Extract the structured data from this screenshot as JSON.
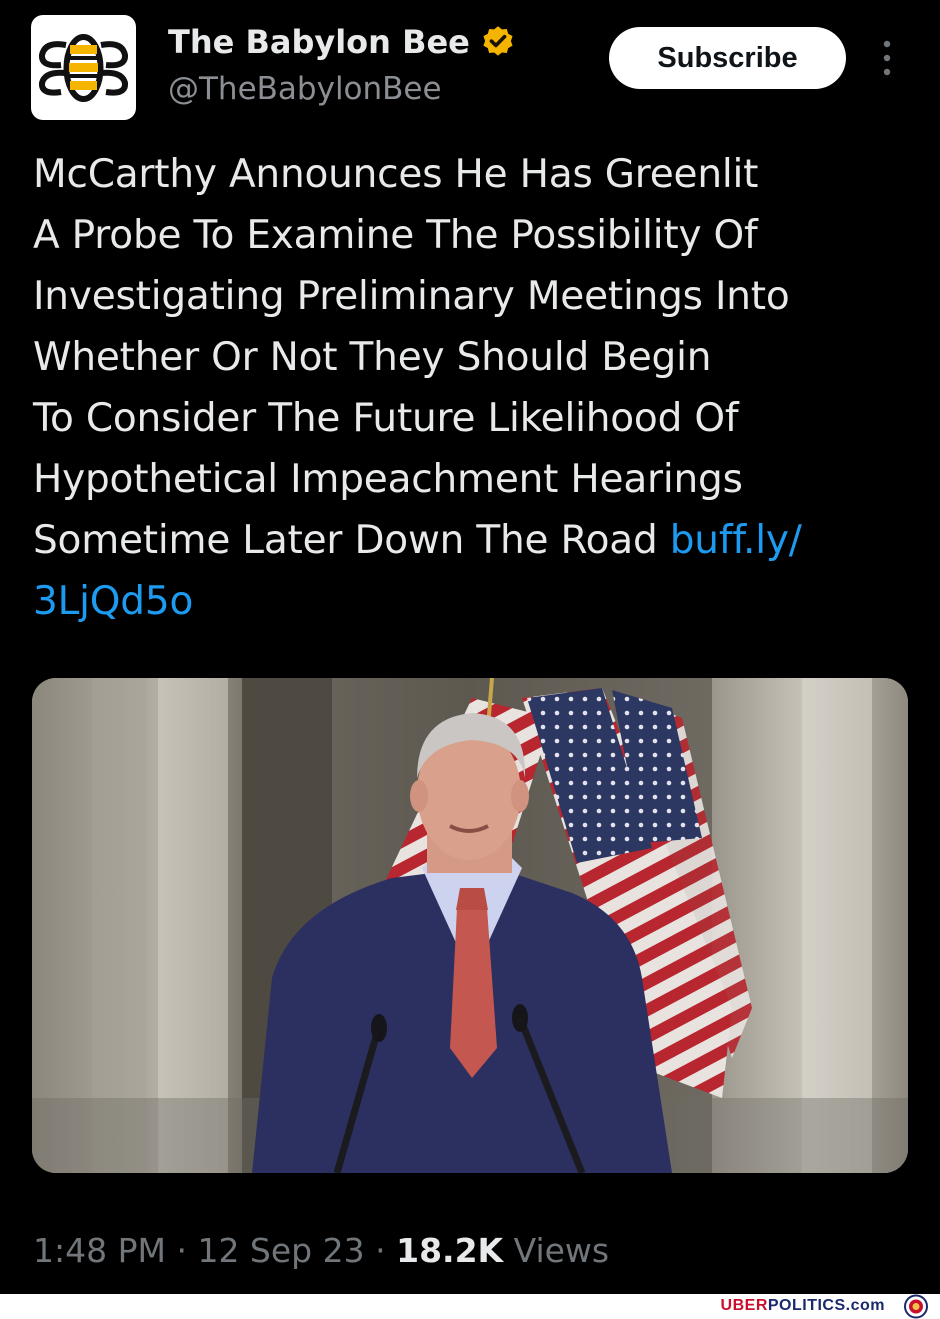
{
  "account": {
    "name": "The Babylon Bee",
    "handle": "@TheBabylonBee",
    "avatar_icon": "bee-logo-icon",
    "verified_icon": "verified-badge-icon",
    "verified_color": "#f5b400"
  },
  "actions": {
    "subscribe_label": "Subscribe",
    "more_icon": "vertical-dots-icon"
  },
  "post": {
    "text_lines": [
      "McCarthy Announces He Has Greenlit",
      "A Probe To Examine The Possibility Of",
      "Investigating Preliminary Meetings Into",
      "Whether Or Not They Should Begin",
      "To Consider The Future Likelihood Of",
      "Hypothetical Impeachment Hearings",
      "Sometime Later Down The Road "
    ],
    "link_part1": "buff.ly/",
    "link_part2": "3LjQd5o",
    "link_color": "#1d9bf0",
    "image": "photo-man-speaking-at-podium-with-flags"
  },
  "meta": {
    "time": "1:48 PM",
    "sep": " · ",
    "date": "12 Sep 23",
    "views_count": "18.2K",
    "views_label": " Views"
  },
  "watermark": {
    "part1": "UBER",
    "part2": "POLITICS.com",
    "logo_icon": "lion-crest-icon"
  }
}
